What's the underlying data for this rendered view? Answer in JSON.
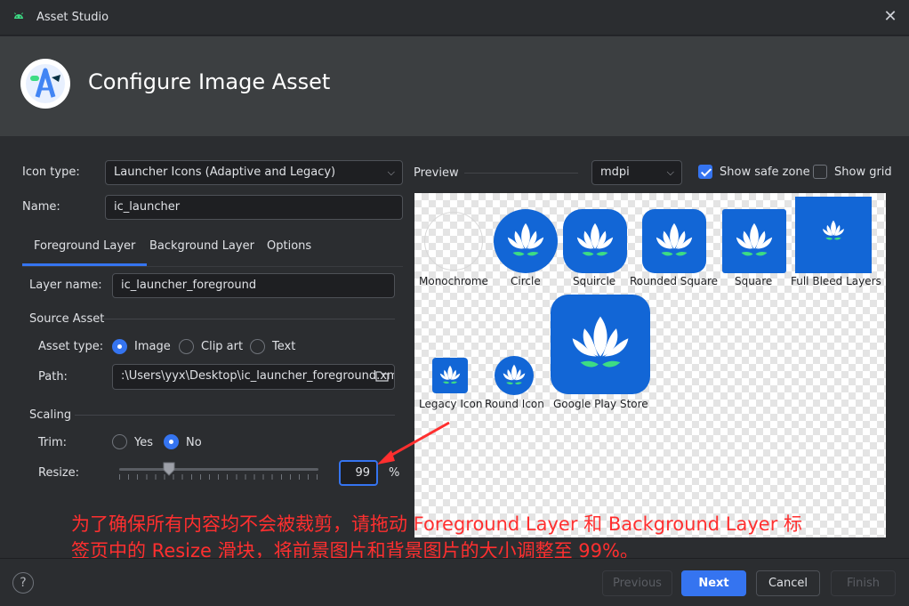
{
  "window": {
    "title": "Asset Studio"
  },
  "header": {
    "title": "Configure Image Asset"
  },
  "form": {
    "icon_type_label": "Icon type:",
    "icon_type_value": "Launcher Icons (Adaptive and Legacy)",
    "name_label": "Name:",
    "name_value": "ic_launcher"
  },
  "tabs": [
    {
      "label": "Foreground Layer",
      "active": true
    },
    {
      "label": "Background Layer",
      "active": false
    },
    {
      "label": "Options",
      "active": false
    }
  ],
  "foreground": {
    "layer_name_label": "Layer name:",
    "layer_name_value": "ic_launcher_foreground",
    "source_asset_heading": "Source Asset",
    "asset_type_label": "Asset type:",
    "asset_type_options": [
      "Image",
      "Clip art",
      "Text"
    ],
    "asset_type_selected": "Image",
    "path_label": "Path:",
    "path_value": ":\\Users\\yyx\\Desktop\\ic_launcher_foreground.xml",
    "scaling_heading": "Scaling",
    "trim_label": "Trim:",
    "trim_options": [
      "Yes",
      "No"
    ],
    "trim_selected": "No",
    "resize_label": "Resize:",
    "resize_value": "99",
    "resize_unit": "%"
  },
  "preview": {
    "label": "Preview",
    "density": "mdpi",
    "show_safe_zone_label": "Show safe zone",
    "show_safe_zone": true,
    "show_grid_label": "Show grid",
    "show_grid": false,
    "icons": [
      "Monochrome",
      "Circle",
      "Squircle",
      "Rounded Square",
      "Square",
      "Full Bleed Layers",
      "Legacy Icon",
      "Round Icon",
      "Google Play Store"
    ]
  },
  "annotation": "为了确保所有内容均不会被裁剪，请拖动 Foreground Layer 和 Background Layer 标签页中的 Resize 滑块，将前景图片和背景图片的大小调整至 99%。",
  "footer": {
    "help": "?",
    "previous": "Previous",
    "next": "Next",
    "cancel": "Cancel",
    "finish": "Finish"
  },
  "colors": {
    "accent": "#3574f0",
    "icon_blue": "#1266d6",
    "leaf_green": "#3ddc84",
    "annotation_red": "#ff2f2f"
  }
}
